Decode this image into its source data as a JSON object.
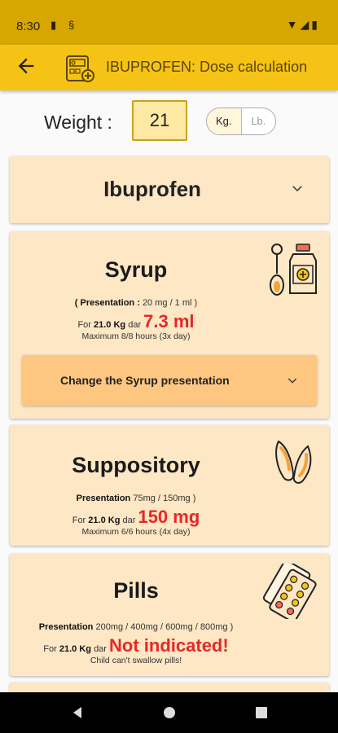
{
  "status": {
    "time": "8:30"
  },
  "appbar": {
    "title": "IBUPROFEN: Dose calculation"
  },
  "weight": {
    "label": "Weight :",
    "value": "21",
    "unit_kg": "Kg.",
    "unit_lb": "Lb."
  },
  "drug": {
    "name": "Ibuprofen"
  },
  "syrup": {
    "title": "Syrup",
    "presentation_label": "( Presentation :",
    "presentation_value": "20 mg / 1 ml )",
    "for_prefix": "For",
    "weight": "21.0 Kg",
    "dar": "dar",
    "dose": "7.3 ml",
    "max": "Maximum 8/8 hours (3x day)",
    "change_label": "Change the Syrup presentation"
  },
  "suppository": {
    "title": "Suppository",
    "presentation_label": "Presentation",
    "presentation_value": "75mg / 150mg )",
    "for_prefix": "For",
    "weight": "21.0 Kg",
    "dar": "dar",
    "dose": "150 mg",
    "max": "Maximum 6/6 hours (4x day)"
  },
  "pills": {
    "title": "Pills",
    "presentation_label": "Presentation",
    "presentation_value": "200mg / 400mg / 600mg / 800mg )",
    "for_prefix": "For",
    "weight": "21.0 Kg",
    "dar": "dar",
    "dose": "Not indicated!",
    "note": "Child can't swallow pills!"
  }
}
